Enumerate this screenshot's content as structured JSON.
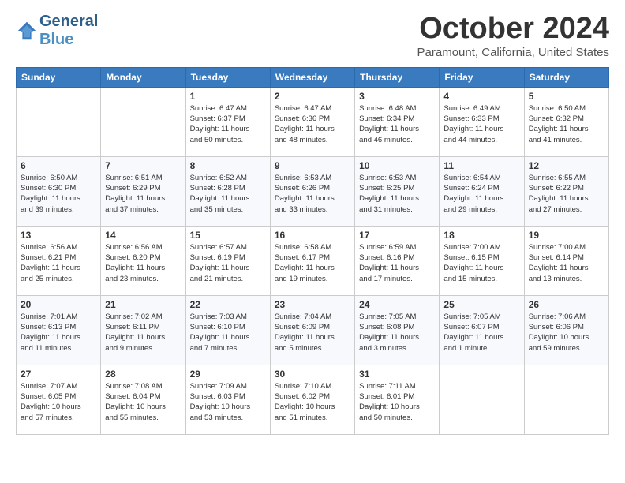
{
  "header": {
    "logo_line1": "General",
    "logo_line2": "Blue",
    "month_title": "October 2024",
    "subtitle": "Paramount, California, United States"
  },
  "weekdays": [
    "Sunday",
    "Monday",
    "Tuesday",
    "Wednesday",
    "Thursday",
    "Friday",
    "Saturday"
  ],
  "weeks": [
    [
      {
        "day": "",
        "info": ""
      },
      {
        "day": "",
        "info": ""
      },
      {
        "day": "1",
        "info": "Sunrise: 6:47 AM\nSunset: 6:37 PM\nDaylight: 11 hours\nand 50 minutes."
      },
      {
        "day": "2",
        "info": "Sunrise: 6:47 AM\nSunset: 6:36 PM\nDaylight: 11 hours\nand 48 minutes."
      },
      {
        "day": "3",
        "info": "Sunrise: 6:48 AM\nSunset: 6:34 PM\nDaylight: 11 hours\nand 46 minutes."
      },
      {
        "day": "4",
        "info": "Sunrise: 6:49 AM\nSunset: 6:33 PM\nDaylight: 11 hours\nand 44 minutes."
      },
      {
        "day": "5",
        "info": "Sunrise: 6:50 AM\nSunset: 6:32 PM\nDaylight: 11 hours\nand 41 minutes."
      }
    ],
    [
      {
        "day": "6",
        "info": "Sunrise: 6:50 AM\nSunset: 6:30 PM\nDaylight: 11 hours\nand 39 minutes."
      },
      {
        "day": "7",
        "info": "Sunrise: 6:51 AM\nSunset: 6:29 PM\nDaylight: 11 hours\nand 37 minutes."
      },
      {
        "day": "8",
        "info": "Sunrise: 6:52 AM\nSunset: 6:28 PM\nDaylight: 11 hours\nand 35 minutes."
      },
      {
        "day": "9",
        "info": "Sunrise: 6:53 AM\nSunset: 6:26 PM\nDaylight: 11 hours\nand 33 minutes."
      },
      {
        "day": "10",
        "info": "Sunrise: 6:53 AM\nSunset: 6:25 PM\nDaylight: 11 hours\nand 31 minutes."
      },
      {
        "day": "11",
        "info": "Sunrise: 6:54 AM\nSunset: 6:24 PM\nDaylight: 11 hours\nand 29 minutes."
      },
      {
        "day": "12",
        "info": "Sunrise: 6:55 AM\nSunset: 6:22 PM\nDaylight: 11 hours\nand 27 minutes."
      }
    ],
    [
      {
        "day": "13",
        "info": "Sunrise: 6:56 AM\nSunset: 6:21 PM\nDaylight: 11 hours\nand 25 minutes."
      },
      {
        "day": "14",
        "info": "Sunrise: 6:56 AM\nSunset: 6:20 PM\nDaylight: 11 hours\nand 23 minutes."
      },
      {
        "day": "15",
        "info": "Sunrise: 6:57 AM\nSunset: 6:19 PM\nDaylight: 11 hours\nand 21 minutes."
      },
      {
        "day": "16",
        "info": "Sunrise: 6:58 AM\nSunset: 6:17 PM\nDaylight: 11 hours\nand 19 minutes."
      },
      {
        "day": "17",
        "info": "Sunrise: 6:59 AM\nSunset: 6:16 PM\nDaylight: 11 hours\nand 17 minutes."
      },
      {
        "day": "18",
        "info": "Sunrise: 7:00 AM\nSunset: 6:15 PM\nDaylight: 11 hours\nand 15 minutes."
      },
      {
        "day": "19",
        "info": "Sunrise: 7:00 AM\nSunset: 6:14 PM\nDaylight: 11 hours\nand 13 minutes."
      }
    ],
    [
      {
        "day": "20",
        "info": "Sunrise: 7:01 AM\nSunset: 6:13 PM\nDaylight: 11 hours\nand 11 minutes."
      },
      {
        "day": "21",
        "info": "Sunrise: 7:02 AM\nSunset: 6:11 PM\nDaylight: 11 hours\nand 9 minutes."
      },
      {
        "day": "22",
        "info": "Sunrise: 7:03 AM\nSunset: 6:10 PM\nDaylight: 11 hours\nand 7 minutes."
      },
      {
        "day": "23",
        "info": "Sunrise: 7:04 AM\nSunset: 6:09 PM\nDaylight: 11 hours\nand 5 minutes."
      },
      {
        "day": "24",
        "info": "Sunrise: 7:05 AM\nSunset: 6:08 PM\nDaylight: 11 hours\nand 3 minutes."
      },
      {
        "day": "25",
        "info": "Sunrise: 7:05 AM\nSunset: 6:07 PM\nDaylight: 11 hours\nand 1 minute."
      },
      {
        "day": "26",
        "info": "Sunrise: 7:06 AM\nSunset: 6:06 PM\nDaylight: 10 hours\nand 59 minutes."
      }
    ],
    [
      {
        "day": "27",
        "info": "Sunrise: 7:07 AM\nSunset: 6:05 PM\nDaylight: 10 hours\nand 57 minutes."
      },
      {
        "day": "28",
        "info": "Sunrise: 7:08 AM\nSunset: 6:04 PM\nDaylight: 10 hours\nand 55 minutes."
      },
      {
        "day": "29",
        "info": "Sunrise: 7:09 AM\nSunset: 6:03 PM\nDaylight: 10 hours\nand 53 minutes."
      },
      {
        "day": "30",
        "info": "Sunrise: 7:10 AM\nSunset: 6:02 PM\nDaylight: 10 hours\nand 51 minutes."
      },
      {
        "day": "31",
        "info": "Sunrise: 7:11 AM\nSunset: 6:01 PM\nDaylight: 10 hours\nand 50 minutes."
      },
      {
        "day": "",
        "info": ""
      },
      {
        "day": "",
        "info": ""
      }
    ]
  ]
}
